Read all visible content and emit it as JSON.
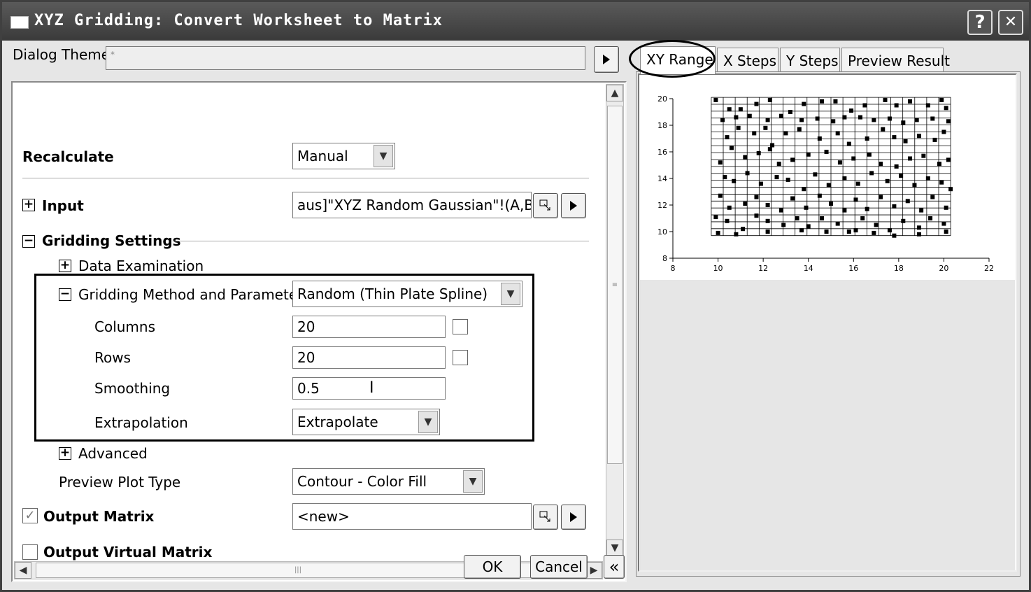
{
  "window": {
    "title": "XYZ Gridding: Convert Worksheet to Matrix",
    "help_button": "?",
    "close_button": "✕"
  },
  "dialog_theme": {
    "label": "Dialog Theme",
    "value": "*"
  },
  "settings": {
    "recalculate": {
      "label": "Recalculate",
      "value": "Manual"
    },
    "input": {
      "label": "Input",
      "value": "aus]\"XYZ Random Gaussian\"!(A,B,C)"
    },
    "gridding_settings": {
      "label": "Gridding Settings"
    },
    "data_examination": {
      "label": "Data Examination"
    },
    "gridding_method": {
      "label": "Gridding Method and Parameters",
      "value": "Random (Thin Plate Spline)"
    },
    "columns": {
      "label": "Columns",
      "value": "20"
    },
    "rows": {
      "label": "Rows",
      "value": "20"
    },
    "smoothing": {
      "label": "Smoothing",
      "value": "0.5"
    },
    "extrapolation": {
      "label": "Extrapolation",
      "value": "Extrapolate"
    },
    "advanced": {
      "label": "Advanced"
    },
    "preview_plot_type": {
      "label": "Preview Plot Type",
      "value": "Contour - Color Fill"
    },
    "output_matrix": {
      "label": "Output Matrix",
      "value": "<new>",
      "checked": true
    },
    "output_virtual_matrix": {
      "label": "Output Virtual Matrix",
      "checked": false
    }
  },
  "buttons": {
    "ok": "OK",
    "cancel": "Cancel",
    "collapse": "«"
  },
  "tabs": [
    "XY Range",
    "X Steps",
    "Y Steps",
    "Preview Result"
  ],
  "chart_data": {
    "type": "scatter",
    "xlim": [
      8,
      22
    ],
    "ylim": [
      8,
      20
    ],
    "x_ticks": [
      "8",
      "10",
      "12",
      "14",
      "16",
      "18",
      "20",
      "22"
    ],
    "y_ticks": [
      "8",
      "10",
      "12",
      "14",
      "16",
      "18",
      "20"
    ],
    "grid": {
      "x_range": [
        9.7,
        20.3
      ],
      "y_range": [
        9.7,
        20.1
      ],
      "columns": 20,
      "rows": 20
    },
    "points": [
      [
        9.9,
        19.9
      ],
      [
        10.5,
        19.2
      ],
      [
        11.0,
        19.2
      ],
      [
        11.7,
        19.6
      ],
      [
        12.3,
        19.9
      ],
      [
        13.2,
        19.0
      ],
      [
        13.8,
        19.6
      ],
      [
        14.6,
        19.8
      ],
      [
        15.2,
        19.8
      ],
      [
        15.9,
        19.1
      ],
      [
        16.5,
        19.5
      ],
      [
        17.4,
        19.9
      ],
      [
        17.9,
        19.5
      ],
      [
        18.5,
        19.8
      ],
      [
        19.3,
        19.5
      ],
      [
        19.9,
        19.9
      ],
      [
        20.1,
        19.3
      ],
      [
        10.2,
        18.4
      ],
      [
        10.8,
        18.6
      ],
      [
        11.4,
        18.7
      ],
      [
        12.2,
        18.4
      ],
      [
        12.8,
        18.7
      ],
      [
        13.7,
        18.4
      ],
      [
        14.4,
        18.5
      ],
      [
        15.1,
        18.3
      ],
      [
        15.6,
        18.6
      ],
      [
        16.3,
        18.6
      ],
      [
        16.9,
        18.4
      ],
      [
        17.6,
        18.5
      ],
      [
        18.2,
        18.2
      ],
      [
        18.8,
        18.4
      ],
      [
        19.5,
        18.5
      ],
      [
        20.2,
        18.3
      ],
      [
        10.4,
        17.1
      ],
      [
        10.9,
        17.8
      ],
      [
        11.6,
        17.4
      ],
      [
        12.1,
        17.8
      ],
      [
        12.4,
        16.5
      ],
      [
        13.0,
        17.4
      ],
      [
        13.6,
        17.7
      ],
      [
        14.5,
        17.0
      ],
      [
        15.3,
        17.4
      ],
      [
        15.8,
        16.6
      ],
      [
        16.6,
        17.0
      ],
      [
        17.3,
        17.7
      ],
      [
        17.8,
        17.1
      ],
      [
        18.3,
        16.8
      ],
      [
        18.9,
        17.2
      ],
      [
        19.6,
        16.9
      ],
      [
        20.0,
        17.5
      ],
      [
        10.1,
        15.2
      ],
      [
        10.6,
        16.3
      ],
      [
        11.2,
        15.6
      ],
      [
        11.8,
        15.9
      ],
      [
        12.3,
        16.2
      ],
      [
        12.7,
        15.1
      ],
      [
        13.3,
        15.4
      ],
      [
        14.0,
        15.8
      ],
      [
        14.8,
        16.0
      ],
      [
        15.4,
        15.2
      ],
      [
        16.0,
        15.5
      ],
      [
        16.7,
        15.8
      ],
      [
        17.2,
        15.1
      ],
      [
        17.9,
        14.9
      ],
      [
        18.5,
        15.5
      ],
      [
        19.1,
        15.7
      ],
      [
        19.8,
        15.1
      ],
      [
        20.2,
        15.4
      ],
      [
        10.3,
        14.1
      ],
      [
        10.7,
        13.8
      ],
      [
        11.3,
        14.4
      ],
      [
        11.9,
        13.6
      ],
      [
        12.6,
        14.1
      ],
      [
        13.1,
        13.9
      ],
      [
        13.8,
        13.2
      ],
      [
        14.3,
        14.3
      ],
      [
        14.9,
        13.5
      ],
      [
        15.6,
        14.0
      ],
      [
        16.2,
        13.6
      ],
      [
        16.8,
        14.4
      ],
      [
        17.5,
        13.8
      ],
      [
        18.1,
        14.2
      ],
      [
        18.7,
        13.5
      ],
      [
        19.3,
        14.0
      ],
      [
        19.9,
        13.7
      ],
      [
        20.3,
        13.2
      ],
      [
        10.1,
        12.7
      ],
      [
        10.5,
        11.8
      ],
      [
        11.2,
        12.1
      ],
      [
        11.7,
        12.6
      ],
      [
        12.2,
        12.0
      ],
      [
        12.8,
        11.6
      ],
      [
        13.3,
        12.5
      ],
      [
        13.9,
        11.8
      ],
      [
        14.5,
        12.7
      ],
      [
        15.0,
        12.1
      ],
      [
        15.6,
        11.6
      ],
      [
        16.1,
        12.4
      ],
      [
        16.6,
        11.7
      ],
      [
        17.2,
        12.6
      ],
      [
        17.8,
        11.9
      ],
      [
        18.4,
        12.3
      ],
      [
        19.0,
        11.6
      ],
      [
        19.5,
        12.6
      ],
      [
        20.1,
        11.8
      ],
      [
        9.9,
        11.1
      ],
      [
        10.4,
        10.8
      ],
      [
        11.1,
        10.2
      ],
      [
        11.7,
        11.2
      ],
      [
        12.2,
        10.8
      ],
      [
        12.9,
        10.5
      ],
      [
        13.5,
        11.0
      ],
      [
        14.0,
        10.4
      ],
      [
        14.6,
        11.0
      ],
      [
        15.3,
        10.6
      ],
      [
        15.8,
        10.0
      ],
      [
        16.4,
        11.0
      ],
      [
        17.0,
        10.5
      ],
      [
        17.6,
        10.1
      ],
      [
        18.2,
        10.8
      ],
      [
        18.9,
        10.3
      ],
      [
        19.4,
        11.0
      ],
      [
        20.0,
        10.6
      ],
      [
        10.0,
        9.9
      ],
      [
        10.8,
        9.8
      ],
      [
        12.2,
        10.0
      ],
      [
        13.7,
        10.1
      ],
      [
        14.8,
        10.0
      ],
      [
        16.1,
        10.1
      ],
      [
        16.9,
        9.9
      ],
      [
        17.8,
        9.7
      ],
      [
        18.9,
        9.8
      ],
      [
        20.1,
        10.0
      ]
    ]
  }
}
